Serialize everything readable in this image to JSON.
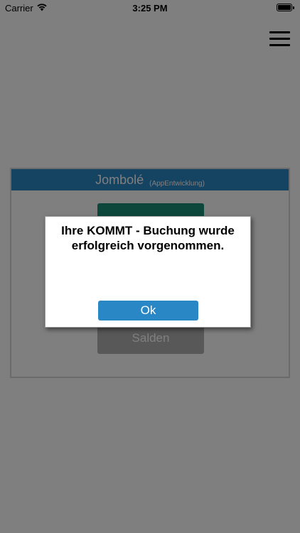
{
  "status_bar": {
    "carrier": "Carrier",
    "time": "3:25 PM",
    "wifi_icon": "wifi-icon",
    "battery_icon": "battery-icon"
  },
  "header": {
    "menu_icon": "hamburger-menu-icon"
  },
  "card": {
    "title": "Jombolé",
    "subtitle": "(AppEntwicklung)",
    "buttons": [
      {
        "label": ""
      },
      {
        "label": "Salden"
      }
    ],
    "accent_color": "#2a87c5",
    "primary_button_color": "#1a8f78"
  },
  "dialog": {
    "message": "Ihre KOMMT - Buchung wurde erfolgreich vorgenommen.",
    "ok_label": "Ok"
  }
}
